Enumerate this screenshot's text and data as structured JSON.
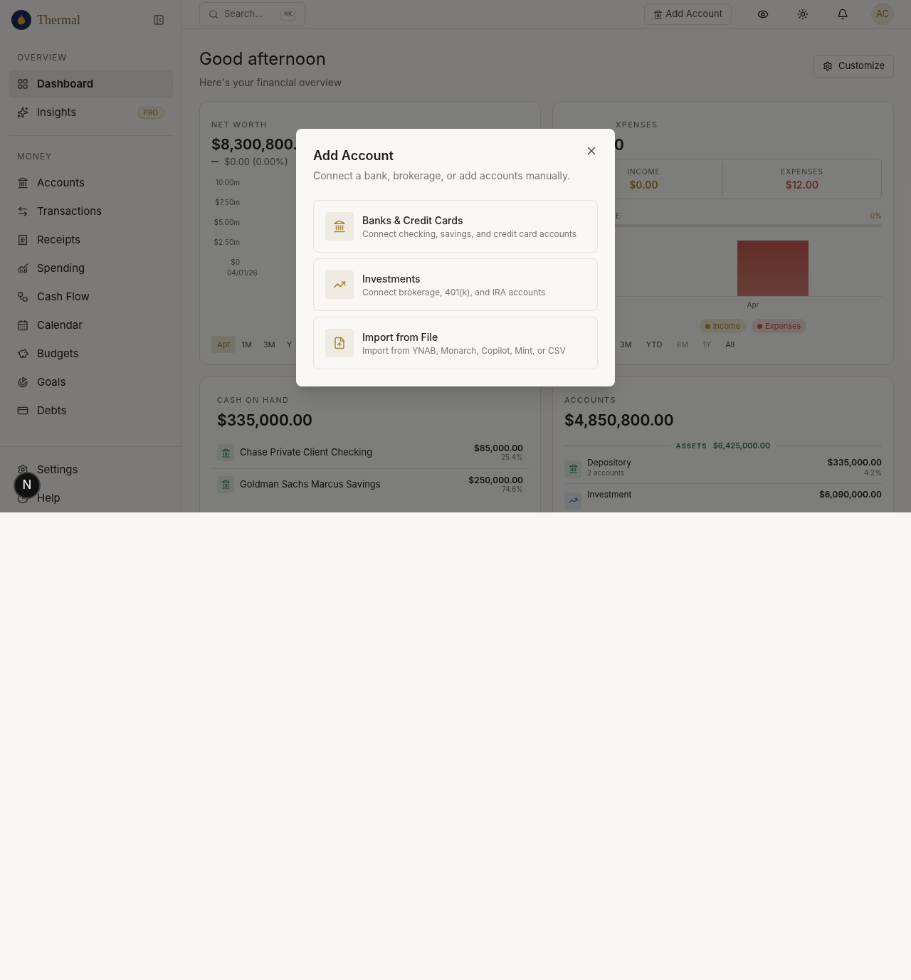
{
  "sidebar": {
    "brand": "Thermal",
    "sections": [
      {
        "title": "OVERVIEW",
        "items": [
          {
            "label": "Dashboard",
            "selected": true
          },
          {
            "label": "Insights",
            "selected": false,
            "badge": "PRO"
          }
        ]
      },
      {
        "title": "MONEY",
        "items": [
          {
            "label": "Accounts",
            "selected": false
          },
          {
            "label": "Transactions",
            "selected": false
          },
          {
            "label": "Receipts",
            "selected": false
          },
          {
            "label": "Spending",
            "selected": false
          },
          {
            "label": "Cash Flow",
            "selected": false
          },
          {
            "label": "Calendar",
            "selected": false
          },
          {
            "label": "Budgets",
            "selected": false
          },
          {
            "label": "Goals",
            "selected": false
          },
          {
            "label": "Debts",
            "selected": false
          }
        ]
      }
    ],
    "footer_items": [
      {
        "label": "Settings"
      },
      {
        "label": "Help"
      }
    ]
  },
  "dev_badge": "N",
  "header": {
    "search": {
      "placeholder": "Search...",
      "shortcut": "⌘K"
    },
    "add_account": "Add Account",
    "avatar": "AC"
  },
  "page": {
    "title": "Good afternoon",
    "subtitle": "Here's your financial overview",
    "customize": "Customize"
  },
  "net_worth": {
    "label": "NET WORTH",
    "value": "$8,300,800.",
    "change": "$0.00 (0.00%)",
    "y_labels": [
      " 10.00m",
      "$7.50m",
      "$5.00m",
      "$2.50m",
      "$0"
    ],
    "x_label": "04/01/26",
    "ranges": [
      {
        "label": "Apr",
        "selected": true
      },
      {
        "label": "1M",
        "selected": false
      },
      {
        "label": "3M",
        "selected": false
      },
      {
        "label": "Y",
        "selected": false
      }
    ]
  },
  "income_expenses": {
    "label": "XPENSES",
    "value": "0",
    "income_label": "INCOME",
    "income": "$0.00",
    "expenses_label": "EXPENSES",
    "expenses": "$12.00",
    "rate": {
      "label": "E",
      "value": "0%",
      "level": 0
    },
    "x_label": "Apr",
    "legend": [
      {
        "label": "Income",
        "kind": "income"
      },
      {
        "label": "Expenses",
        "kind": "expense"
      }
    ],
    "ranges": [
      {
        "label": "3M",
        "disabled": false
      },
      {
        "label": "YTD",
        "disabled": false
      },
      {
        "label": "6M",
        "disabled": true
      },
      {
        "label": "1Y",
        "disabled": true
      },
      {
        "label": "All",
        "disabled": false
      }
    ]
  },
  "cash_on_hand": {
    "label": "CASH ON HAND",
    "value": "$335,000.00",
    "rows": [
      {
        "name": "Chase Private Client Checking",
        "amount": "$85,000.00",
        "share": "25.4%"
      },
      {
        "name": "Goldman Sachs Marcus Savings",
        "amount": "$250,000.00",
        "share": "74.6%"
      }
    ]
  },
  "accounts": {
    "label": "ACCOUNTS",
    "value": "$4,850,800.00",
    "assets_label": "ASSETS",
    "assets": "$6,425,000.00",
    "rows": [
      {
        "kind": "bank",
        "name": "Depository",
        "detail": "2 accounts",
        "amount": "$335,000.00",
        "share": "4.2%"
      },
      {
        "kind": "investment",
        "name": "Investment",
        "amount": "$6,090,000.00"
      }
    ]
  },
  "modal": {
    "title": "Add Account",
    "subtitle": "Connect a bank, brokerage, or add accounts manually.",
    "options": [
      {
        "title": "Banks & Credit Cards",
        "description": "Connect checking, savings, and credit card accounts"
      },
      {
        "title": "Investments",
        "description": "Connect brokerage, 401(k), and IRA accounts"
      },
      {
        "title": "Import from File",
        "description": "Import from YNAB, Monarch, Copilot, Mint, or CSV"
      }
    ]
  }
}
